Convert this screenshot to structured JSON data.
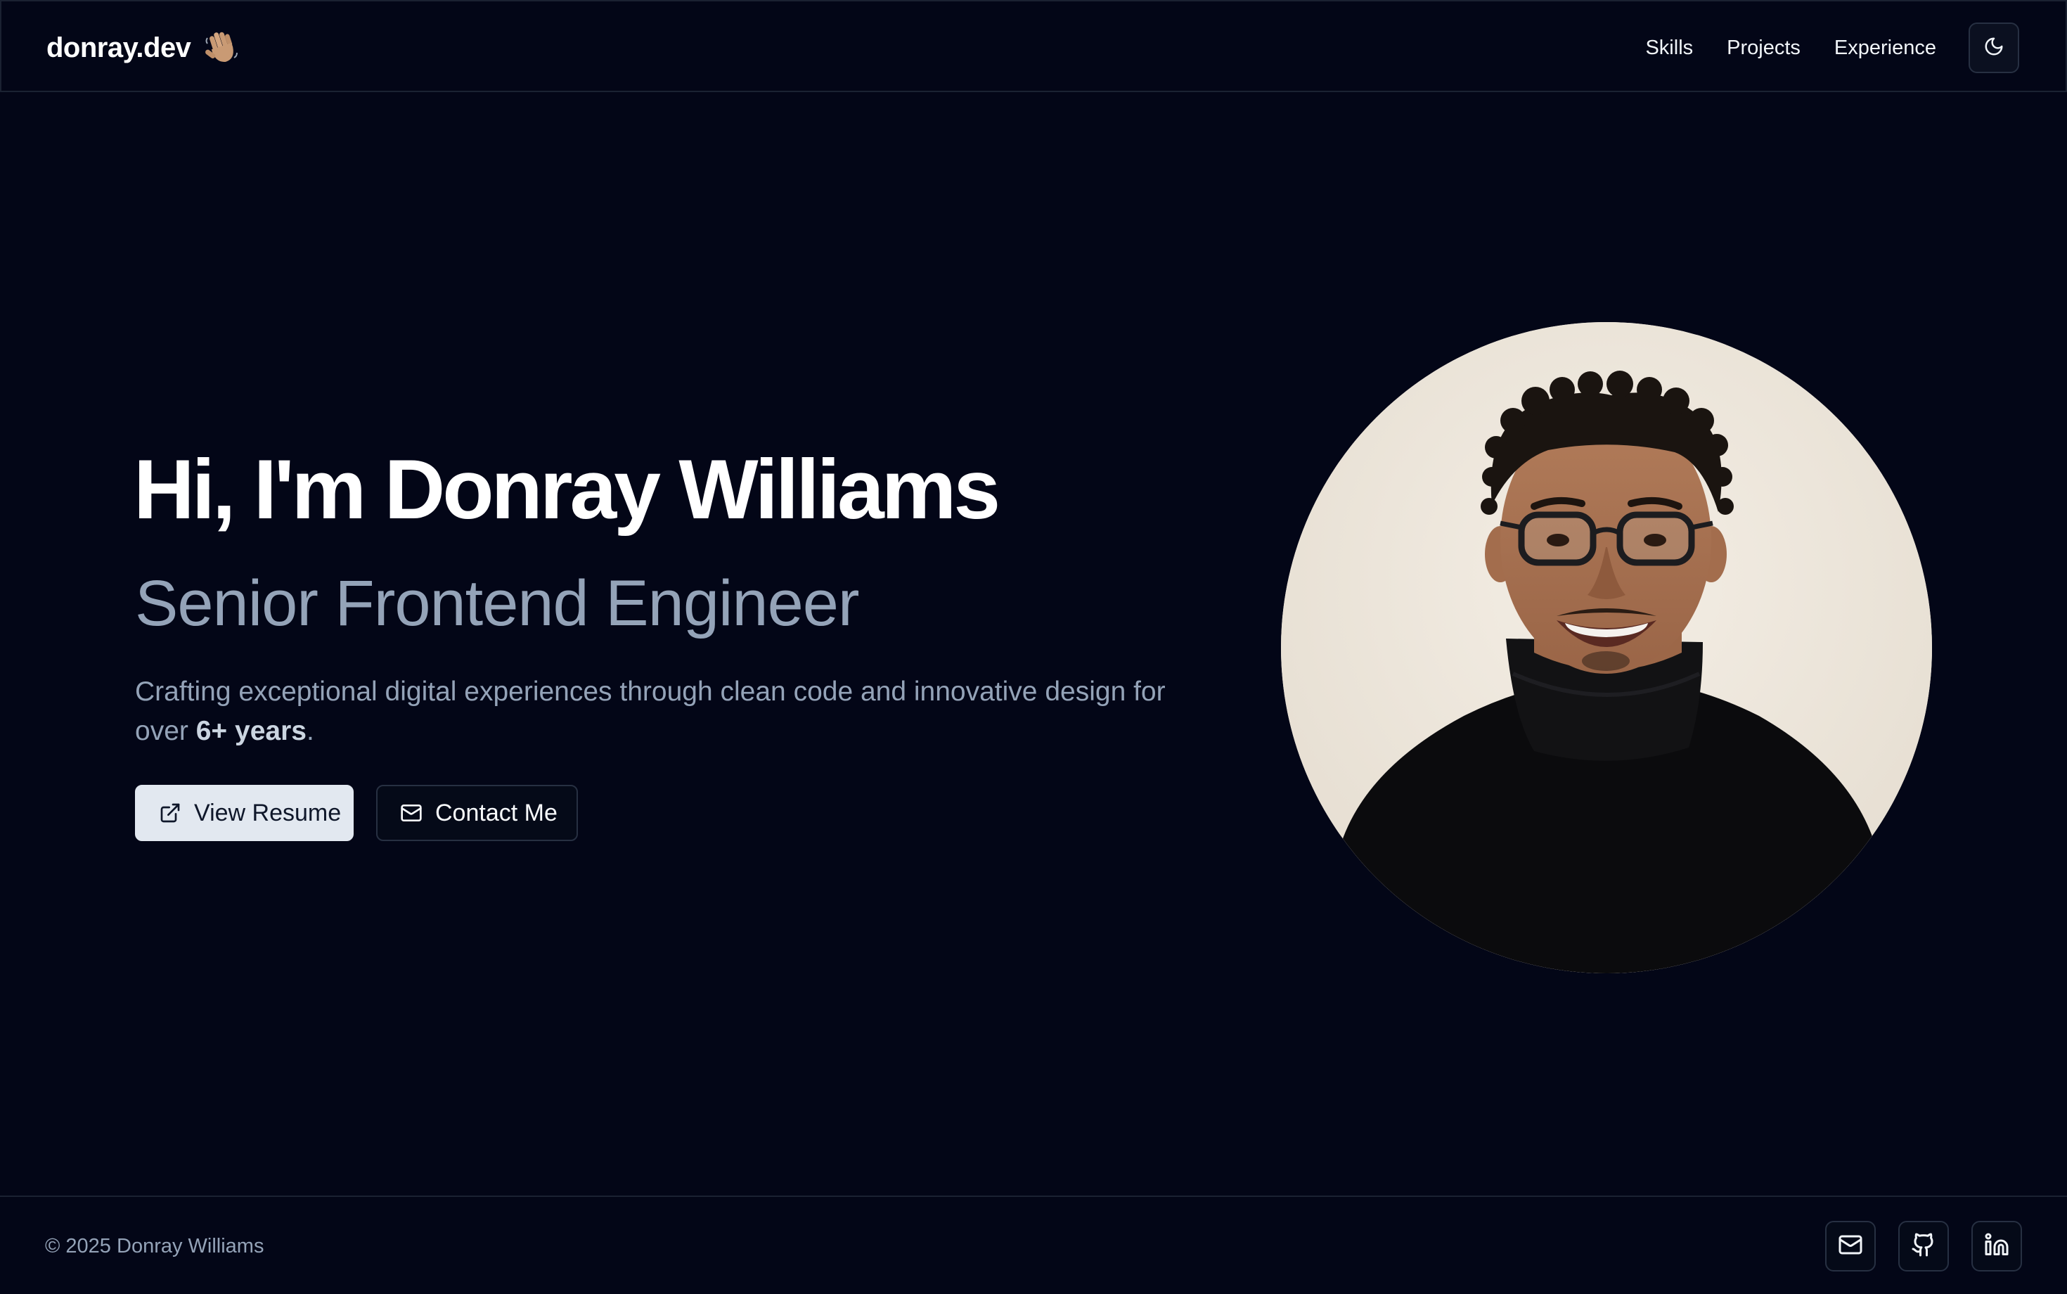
{
  "header": {
    "brand": "donray.dev",
    "brand_icon": "waving-hand-icon",
    "nav": [
      {
        "label": "Skills"
      },
      {
        "label": "Projects"
      },
      {
        "label": "Experience"
      }
    ],
    "theme_toggle_icon": "moon-icon"
  },
  "hero": {
    "title": "Hi, I'm Donray Williams",
    "subtitle": "Senior Frontend Engineer",
    "description_prefix": "Crafting exceptional digital experiences through clean code and innovative design for over ",
    "description_highlight": "6+ years",
    "description_suffix": ".",
    "primary_button": {
      "label": "View Resume",
      "icon": "external-link-icon"
    },
    "secondary_button": {
      "label": "Contact Me",
      "icon": "mail-icon"
    },
    "portrait_alt": "Portrait of Donray Williams"
  },
  "footer": {
    "copyright": "© 2025 Donray Williams",
    "social": [
      {
        "name": "email",
        "icon": "mail-icon"
      },
      {
        "name": "github",
        "icon": "github-icon"
      },
      {
        "name": "linkedin",
        "icon": "linkedin-icon"
      }
    ]
  },
  "colors": {
    "background": "#030617",
    "border": "#1b2232",
    "muted_text": "#94a3b8",
    "primary_button_bg": "#e2e8f0"
  }
}
